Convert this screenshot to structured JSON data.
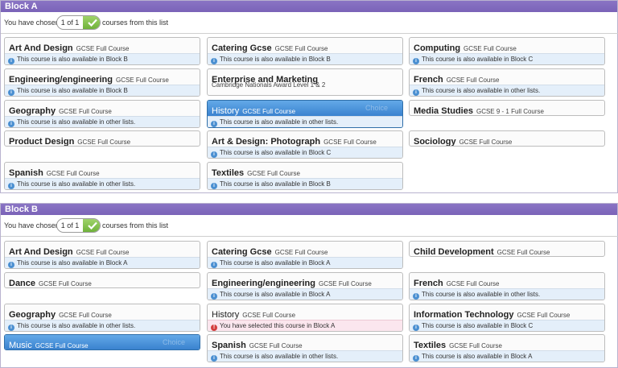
{
  "blockA": {
    "header": "Block A",
    "chosen_prefix": "You have chosen",
    "counter": "1 of 1",
    "chosen_suffix": "courses from this list",
    "courses": [
      {
        "title": "Art And Design",
        "sub": "GCSE Full Course",
        "note": "This course is also available in Block B"
      },
      {
        "title": "Catering Gcse",
        "sub": "GCSE Full Course",
        "note": "This course is also available in Block B"
      },
      {
        "title": "Computing",
        "sub": "GCSE Full Course",
        "note": "This course is also available in Block C"
      },
      {
        "title": "Engineering/engineering",
        "sub": "GCSE Full Course",
        "note": "This course is also available in Block B"
      },
      {
        "title": "Enterprise and Marketing",
        "sub2": "Cambridge Nationals Award Level 1 & 2"
      },
      {
        "title": "French",
        "sub": "GCSE Full Course",
        "note": "This course is also available in other lists."
      },
      {
        "title": "Geography",
        "sub": "GCSE Full Course",
        "note": "This course is also available in other lists."
      },
      {
        "title": "History",
        "sub": "GCSE Full Course",
        "note": "This course is also available in other lists.",
        "tag": "Choice"
      },
      {
        "title": "Media Studies",
        "sub": "GCSE 9 - 1 Full Course"
      },
      {
        "title": "Product Design",
        "sub": "GCSE Full Course"
      },
      {
        "title": "Art & Design: Photograph",
        "sub": "GCSE Full Course",
        "note": "This course is also available in Block C"
      },
      {
        "title": "Sociology",
        "sub": "GCSE Full Course"
      },
      {
        "title": "Spanish",
        "sub": "GCSE Full Course",
        "note": "This course is also available in other lists."
      },
      {
        "title": "Textiles",
        "sub": "GCSE Full Course",
        "note": "This course is also available in Block B"
      }
    ]
  },
  "blockB": {
    "header": "Block B",
    "chosen_prefix": "You have chosen",
    "counter": "1 of 1",
    "chosen_suffix": "courses from this list",
    "courses": [
      {
        "title": "Art And Design",
        "sub": "GCSE Full Course",
        "note": "This course is also available in Block A"
      },
      {
        "title": "Catering Gcse",
        "sub": "GCSE Full Course",
        "note": "This course is also available in Block A"
      },
      {
        "title": "Child Development",
        "sub": "GCSE Full Course"
      },
      {
        "title": "Dance",
        "sub": "GCSE Full Course"
      },
      {
        "title": "Engineering/engineering",
        "sub": "GCSE Full Course",
        "note": "This course is also available in Block A"
      },
      {
        "title": "French",
        "sub": "GCSE Full Course",
        "note": "This course is also available in other lists."
      },
      {
        "title": "Geography",
        "sub": "GCSE Full Course",
        "note": "This course is also available in other lists."
      },
      {
        "title": "History",
        "sub": "GCSE Full Course",
        "note": "You have selected this course in Block A"
      },
      {
        "title": "Information Technology",
        "sub": "GCSE Full Course",
        "note": "This course is also available in Block C"
      },
      {
        "title": "Music",
        "sub": "GCSE Full Course",
        "tag": "Choice"
      },
      {
        "title": "Spanish",
        "sub": "GCSE Full Course",
        "note": "This course is also available in other lists."
      },
      {
        "title": "Textiles",
        "sub": "GCSE Full Course",
        "note": "This course is also available in Block A"
      }
    ]
  }
}
